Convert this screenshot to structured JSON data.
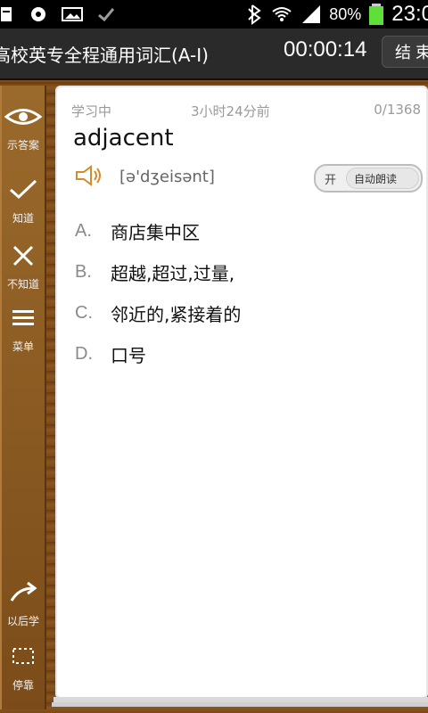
{
  "status_bar": {
    "battery_percent": "80%",
    "time": "23:0"
  },
  "title_bar": {
    "title": "高校英专全程通用词汇(A-I)",
    "timer": "00:00:14",
    "end_button": "结 束"
  },
  "sidebar": {
    "items": [
      {
        "label": "示答案",
        "icon": "eye-icon"
      },
      {
        "label": "知道",
        "icon": "check-icon"
      },
      {
        "label": "不知道",
        "icon": "x-icon"
      },
      {
        "label": "菜单",
        "icon": "menu-icon"
      },
      {
        "label": "以后学",
        "icon": "forward-arrow-icon"
      },
      {
        "label": "停靠",
        "icon": "dock-icon"
      }
    ]
  },
  "card": {
    "status": "学习中",
    "last_time": "3小时24分前",
    "progress": "0/1368",
    "word": "adjacent",
    "phonetic": "[ə'dʒeisənt]",
    "toggle": {
      "on_label": "开",
      "label": "自动朗读"
    },
    "options": [
      {
        "letter": "A.",
        "text": "商店集中区"
      },
      {
        "letter": "B.",
        "text": "超越,超过,过量,"
      },
      {
        "letter": "C.",
        "text": "邻近的,紧接着的"
      },
      {
        "letter": "D.",
        "text": "口号"
      }
    ]
  },
  "colors": {
    "wood_dark": "#6a3b10",
    "wood_light": "#9a6a2c",
    "card_bg": "#ffffff",
    "accent_speaker": "#d38b2c"
  }
}
